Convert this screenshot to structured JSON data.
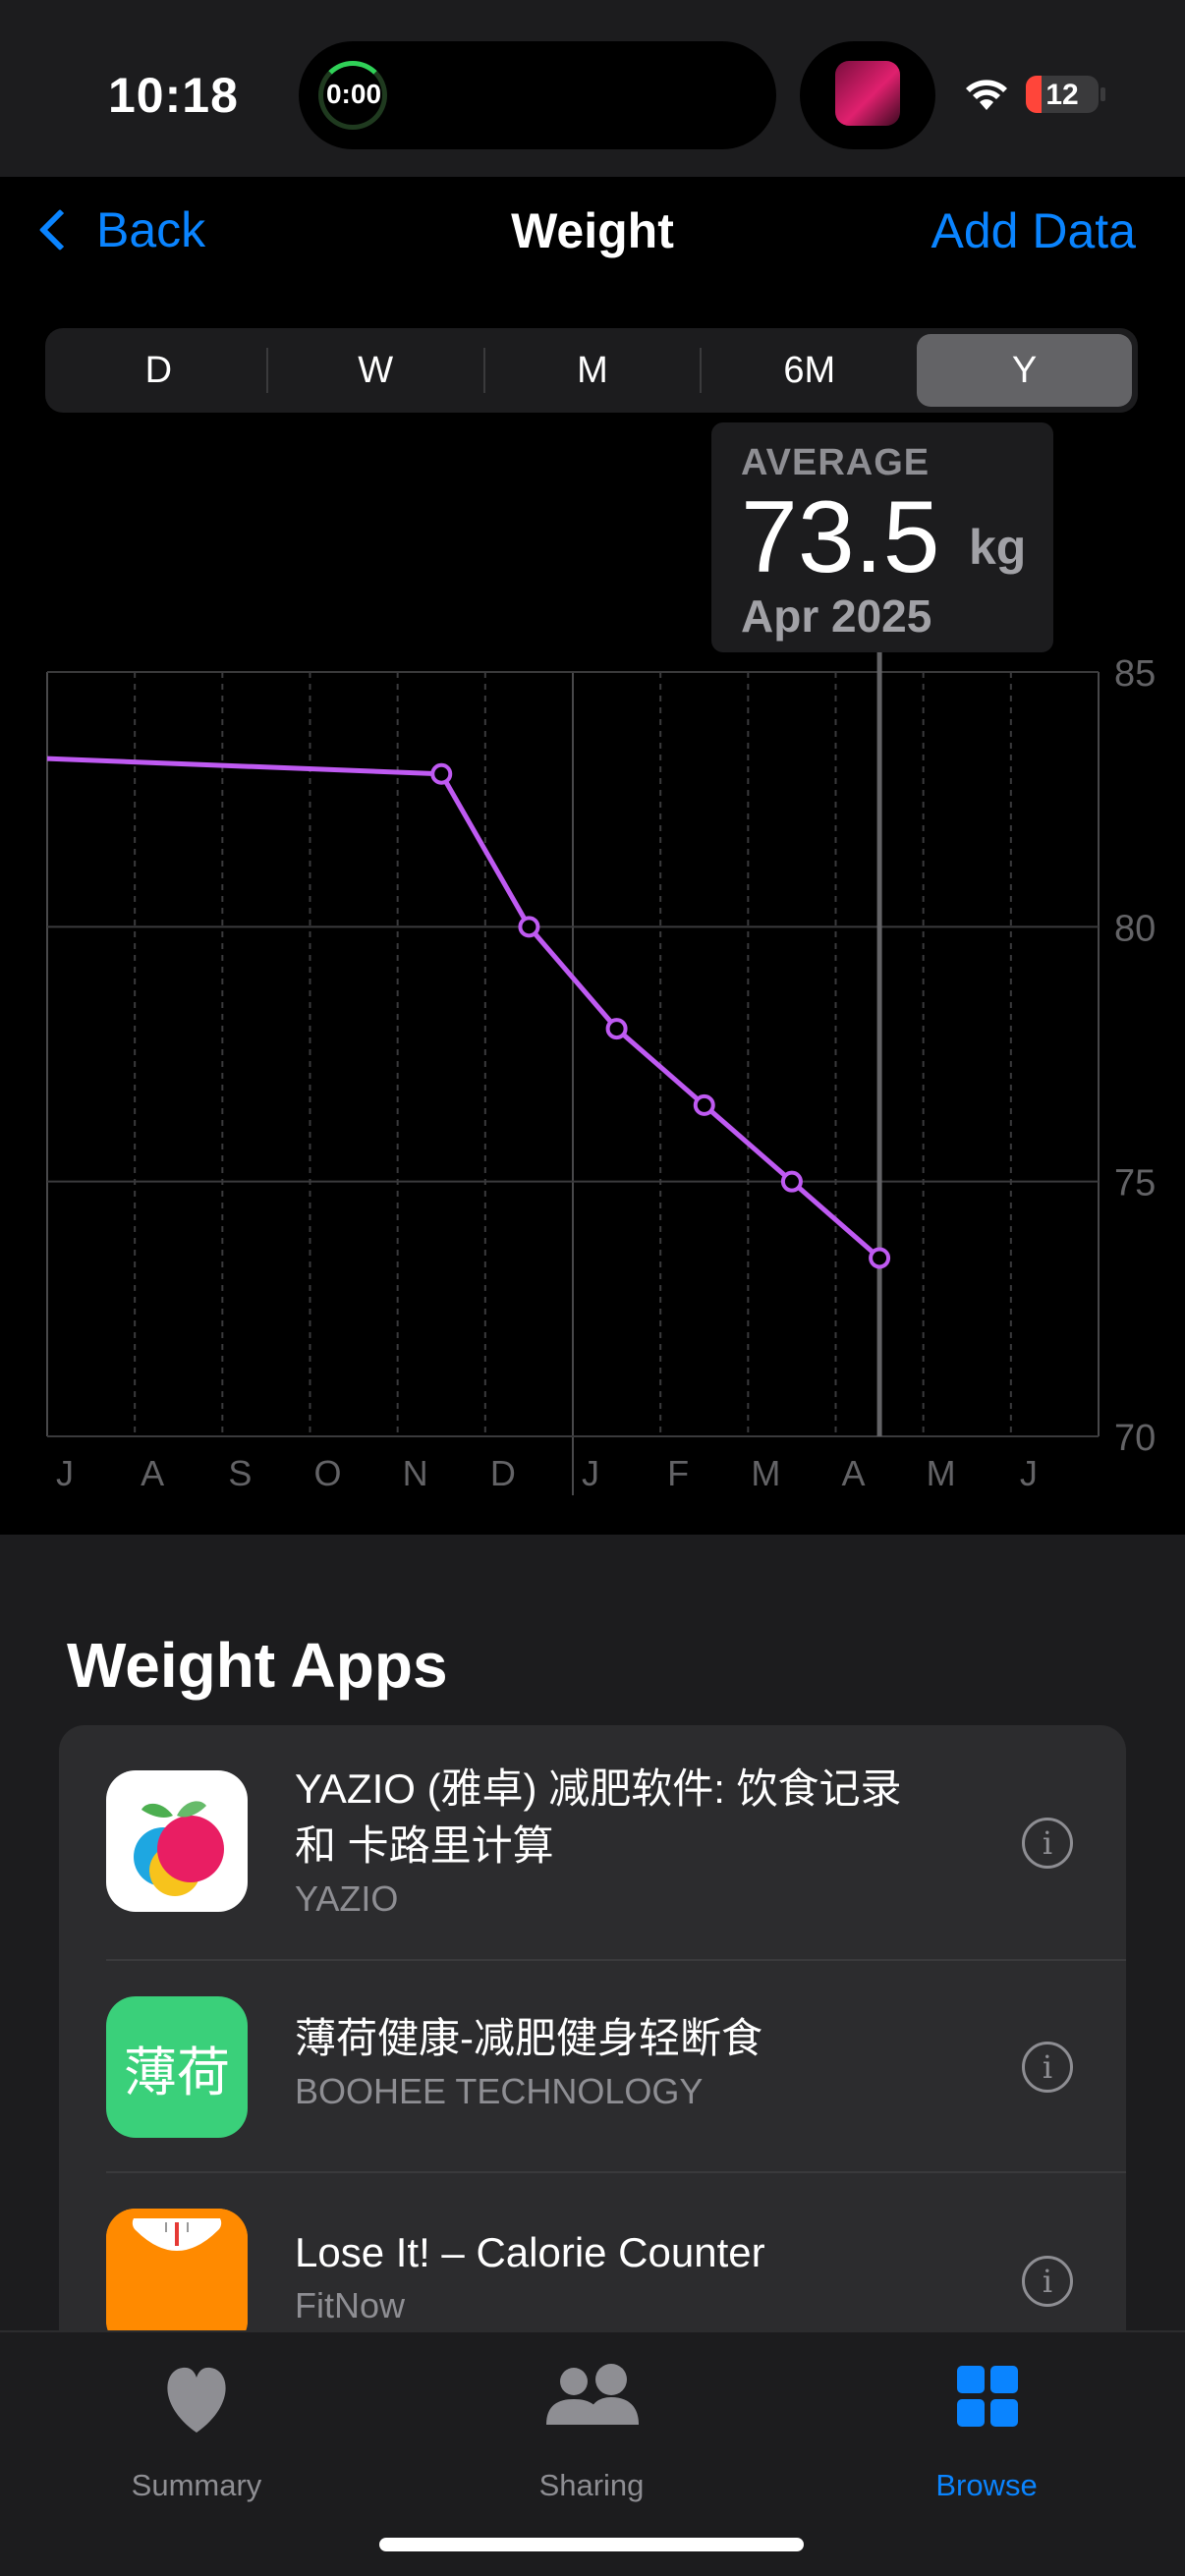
{
  "status_bar": {
    "time": "10:18",
    "timer": "0:00",
    "battery": "12"
  },
  "nav": {
    "back_label": "Back",
    "title": "Weight",
    "add_label": "Add Data"
  },
  "segments": [
    {
      "label": "D",
      "selected": false
    },
    {
      "label": "W",
      "selected": false
    },
    {
      "label": "M",
      "selected": false
    },
    {
      "label": "6M",
      "selected": false
    },
    {
      "label": "Y",
      "selected": true
    }
  ],
  "average": {
    "label": "AVERAGE",
    "value": "73.5",
    "unit": "kg",
    "date": "Apr 2025"
  },
  "chart_data": {
    "type": "line",
    "categories": [
      "J",
      "A",
      "S",
      "O",
      "N",
      "D",
      "J",
      "F",
      "M",
      "A",
      "M",
      "J"
    ],
    "y_ticks": [
      "85",
      "80",
      "75",
      "70"
    ],
    "ylim": [
      70,
      85
    ],
    "series": [
      {
        "color": "#bf5af2",
        "points": [
          {
            "x": 0.0,
            "y": 83.3
          },
          {
            "x": 4.5,
            "y": 83.0
          },
          {
            "x": 5.5,
            "y": 80.0
          },
          {
            "x": 6.5,
            "y": 78.0
          },
          {
            "x": 7.5,
            "y": 76.5
          },
          {
            "x": 8.5,
            "y": 75.0
          },
          {
            "x": 9.5,
            "y": 73.5
          }
        ],
        "marked_from_index": 1
      }
    ],
    "selected_x": 9.5,
    "grid": true
  },
  "apps": {
    "heading": "Weight Apps",
    "items": [
      {
        "title_line1": "YAZIO (雅卓) 减肥软件: 饮食记录",
        "title_line2": "和 卡路里计算",
        "developer": "YAZIO",
        "icon": "yazio-app-icon"
      },
      {
        "title_line1": "薄荷健康-减肥健身轻断食",
        "title_line2": "",
        "developer": "BOOHEE TECHNOLOGY",
        "icon": "boohee-app-icon",
        "icon_text": "薄荷"
      },
      {
        "title_line1": "Lose It! – Calorie Counter",
        "title_line2": "",
        "developer": "FitNow",
        "icon": "loseit-app-icon"
      }
    ],
    "info_glyph": "i"
  },
  "tabs": [
    {
      "label": "Summary",
      "icon": "heart-icon",
      "active": false
    },
    {
      "label": "Sharing",
      "icon": "people-icon",
      "active": false
    },
    {
      "label": "Browse",
      "icon": "grid-icon",
      "active": true
    }
  ],
  "colors": {
    "accent": "#0a84ff",
    "series": "#bf5af2",
    "background": "#000000",
    "card": "#2c2c2e"
  }
}
